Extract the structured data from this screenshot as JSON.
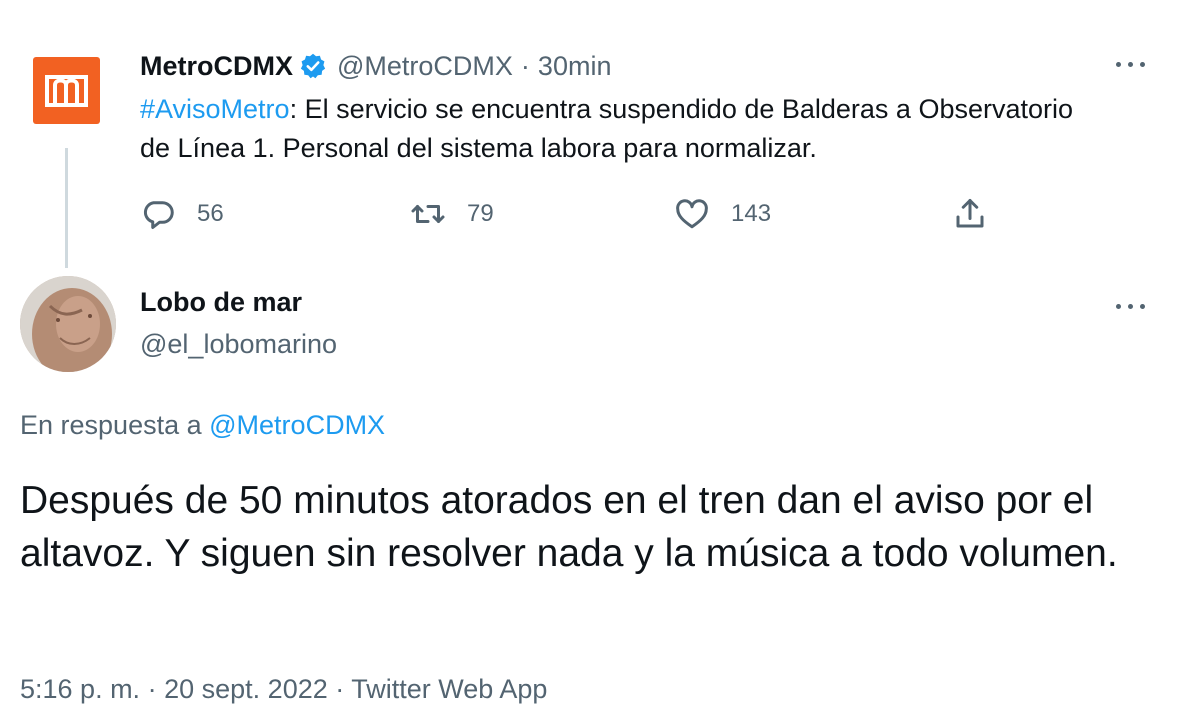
{
  "quoted_tweet": {
    "display_name": "MetroCDMX",
    "handle": "@MetroCDMX",
    "separator": "·",
    "time": "30min",
    "hashtag": "#AvisoMetro",
    "text": ": El servicio se encuentra suspendido de Balderas a Observatorio de Línea 1. Personal del sistema labora para normalizar.",
    "replies": "56",
    "retweets": "79",
    "likes": "143",
    "logo_color": "#f26122"
  },
  "reply_tweet": {
    "display_name": "Lobo de mar",
    "handle": "@el_lobomarino",
    "reply_prefix": "En respuesta a",
    "reply_mention": "@MetroCDMX",
    "text": "Después de 50 minutos atorados en el tren dan el aviso por el altavoz. Y siguen sin resolver nada y la música a todo volumen.",
    "time": "5:16 p. m.",
    "date": "20 sept. 2022",
    "separator": "·",
    "source": "Twitter Web App"
  },
  "colors": {
    "link": "#1d9bf0",
    "secondary_text": "#536471",
    "primary_text": "#0f1419"
  }
}
